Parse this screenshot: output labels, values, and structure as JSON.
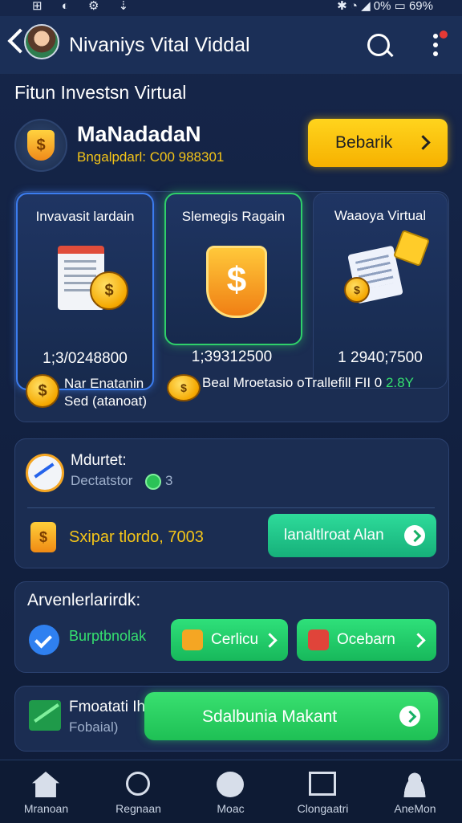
{
  "status_bar": {
    "left_icons": "⊞ ◐ ⚙ ⇣",
    "right_text": "✱ ◔ ◢ 0% ▭ 69%"
  },
  "header": {
    "title": "Nivaniys Vital Viddal"
  },
  "section": {
    "title": "Fitun Investsn Virtual"
  },
  "profile": {
    "name": "MaNadadaN",
    "balance": "Bngalpdarl: C00 988301",
    "action_label": "Bebarik"
  },
  "cards": [
    {
      "title": "Invavasit lardain",
      "value": "1;3/0248800"
    },
    {
      "title": "Slemegis Ragain",
      "value": "1;39312500"
    },
    {
      "title": "Waaoya Virtual",
      "value": "1 2940;7500"
    }
  ],
  "investment_footer": {
    "left_line1": "Nar Enatanin",
    "left_line2": "Sed (atanoat)",
    "right_text": "Beal Mroetasio oTrallefill FII 0",
    "right_highlight": "2.8Y"
  },
  "market": {
    "title": "Mdurtet:",
    "subtitle": "Dectatstor",
    "dot_number": "3",
    "value": "Sxipar tlordo, 7003",
    "button_label": "lanaltlroat Alan"
  },
  "agenda": {
    "title": "Arvenlerlarirdk:",
    "subtitle": "Burptbnolak",
    "btn1_label": "Cerlicu",
    "btn2_label": "Ocebarn"
  },
  "footer_panel": {
    "title": "Fmoatati Ih",
    "subtitle": "Fobaial)",
    "button_label": "Sdalbunia Makant"
  },
  "nav": [
    {
      "label": "Mranoan",
      "icon": "home-icon"
    },
    {
      "label": "Regnaan",
      "icon": "search-icon"
    },
    {
      "label": "Moac",
      "icon": "shield-icon"
    },
    {
      "label": "Clongaatri",
      "icon": "screen-icon"
    },
    {
      "label": "AneMon",
      "icon": "user-icon"
    }
  ],
  "colors": {
    "accent_yellow": "#f6b100",
    "accent_green": "#2fe07a",
    "accent_blue": "#3c7df0",
    "background": "#132243"
  }
}
